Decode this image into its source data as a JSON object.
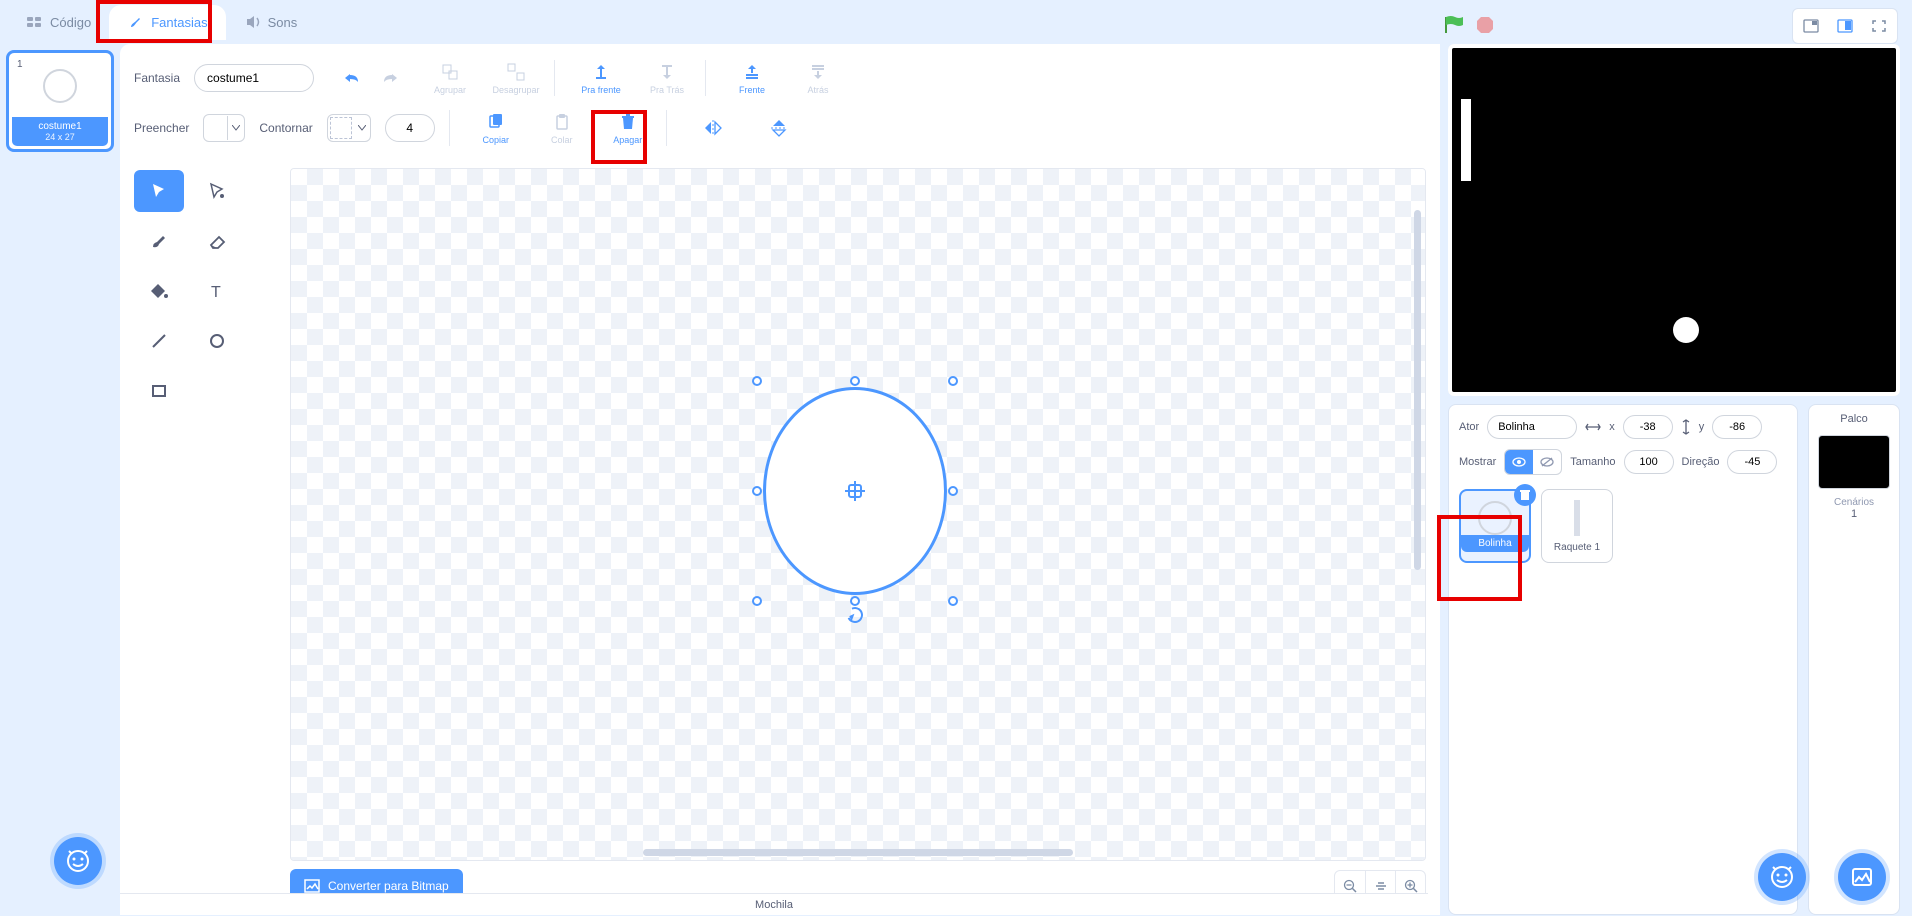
{
  "tabs": {
    "code": "Código",
    "costumes": "Fantasias",
    "sounds": "Sons"
  },
  "costume_list": {
    "index": "1",
    "name": "costume1",
    "size": "24 x 27"
  },
  "editor": {
    "costume_label": "Fantasia",
    "costume_name": "costume1",
    "group": "Agrupar",
    "ungroup": "Desagrupar",
    "forward": "Pra frente",
    "backward": "Pra Trás",
    "front": "Frente",
    "back": "Atrás",
    "fill_label": "Preencher",
    "outline_label": "Contornar",
    "outline_width": "4",
    "copy": "Copiar",
    "paste": "Colar",
    "delete": "Apagar",
    "convert": "Converter para Bitmap"
  },
  "sprite_panel": {
    "actor_label": "Ator",
    "actor_name": "Bolinha",
    "x_label": "x",
    "x_value": "-38",
    "y_label": "y",
    "y_value": "-86",
    "show_label": "Mostrar",
    "size_label": "Tamanho",
    "size_value": "100",
    "direction_label": "Direção",
    "direction_value": "-45",
    "sprites": {
      "ball": "Bolinha",
      "paddle": "Raquete 1"
    }
  },
  "stage": {
    "label": "Palco",
    "backdrops_label": "Cenários",
    "backdrops_count": "1"
  },
  "backpack_label": "Mochila"
}
